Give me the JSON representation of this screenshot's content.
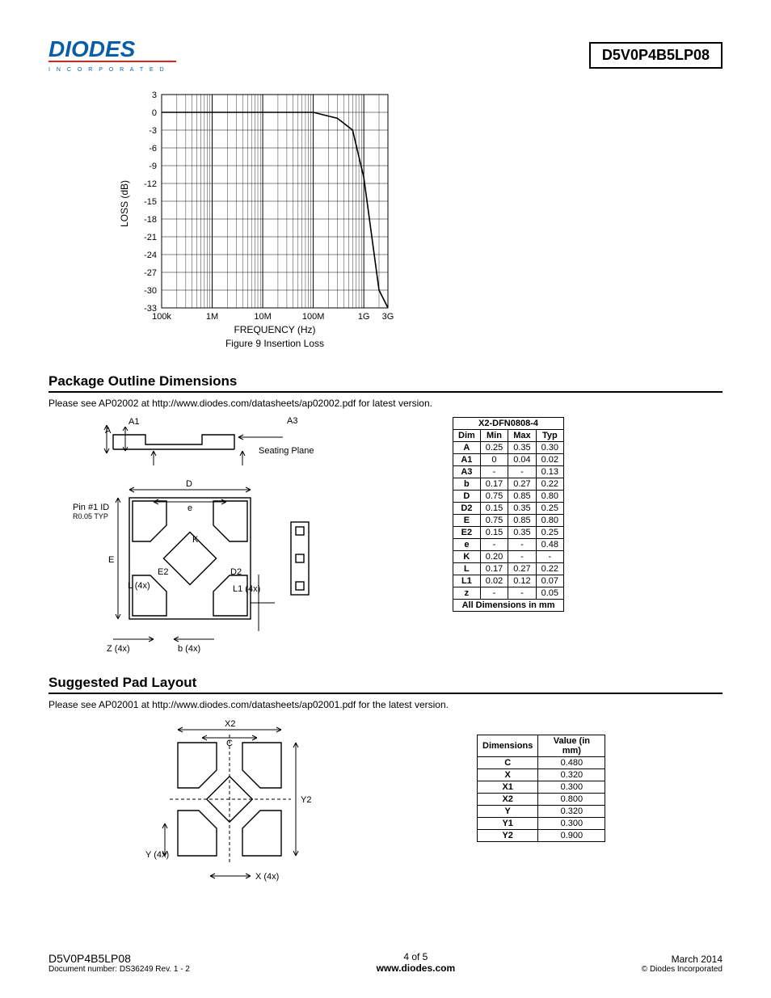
{
  "header": {
    "part_number": "D5V0P4B5LP08",
    "logo_tag": "I N C O R P O R A T E D"
  },
  "chart_data": {
    "type": "line",
    "title": "Figure 9 Insertion Loss",
    "xlabel": "FREQUENCY (Hz)",
    "ylabel": "LOSS (dB)",
    "y_ticks": [
      3,
      0,
      -3,
      -6,
      -9,
      -12,
      -15,
      -18,
      -21,
      -24,
      -27,
      -30,
      -33
    ],
    "x_ticks": [
      "100k",
      "1M",
      "10M",
      "100M",
      "1G",
      "3G"
    ],
    "ylim": [
      -33,
      3
    ],
    "series": [
      {
        "name": "Insertion Loss",
        "points": [
          {
            "f": "100k",
            "db": 0
          },
          {
            "f": "1M",
            "db": 0
          },
          {
            "f": "10M",
            "db": 0
          },
          {
            "f": "100M",
            "db": 0
          },
          {
            "f": "300M",
            "db": -1
          },
          {
            "f": "600M",
            "db": -3
          },
          {
            "f": "1G",
            "db": -11
          },
          {
            "f": "2G",
            "db": -30
          },
          {
            "f": "3G",
            "db": -33
          }
        ]
      }
    ]
  },
  "sections": {
    "pkg": {
      "title": "Package Outline Dimensions",
      "note": "Please see AP02002 at http://www.diodes.com/datasheets/ap02002.pdf for latest version."
    },
    "pad": {
      "title": "Suggested Pad Layout",
      "note": "Please see AP02001 at http://www.diodes.com/datasheets/ap02001.pdf for the latest version."
    }
  },
  "pkg_diagram": {
    "labels": [
      "A",
      "A1",
      "A3",
      "Seating Plane",
      "Pin #1 ID",
      "R0.05 TYP",
      "D",
      "e",
      "K",
      "E",
      "E2",
      "D2",
      "L (4x)",
      "L1 (4x)",
      "Z (4x)",
      "b (4x)"
    ]
  },
  "dim_table": {
    "title": "X2-DFN0808-4",
    "headers": [
      "Dim",
      "Min",
      "Max",
      "Typ"
    ],
    "rows": [
      [
        "A",
        "0.25",
        "0.35",
        "0.30"
      ],
      [
        "A1",
        "0",
        "0.04",
        "0.02"
      ],
      [
        "A3",
        "-",
        "-",
        "0.13"
      ],
      [
        "b",
        "0.17",
        "0.27",
        "0.22"
      ],
      [
        "D",
        "0.75",
        "0.85",
        "0.80"
      ],
      [
        "D2",
        "0.15",
        "0.35",
        "0.25"
      ],
      [
        "E",
        "0.75",
        "0.85",
        "0.80"
      ],
      [
        "E2",
        "0.15",
        "0.35",
        "0.25"
      ],
      [
        "e",
        "-",
        "-",
        "0.48"
      ],
      [
        "K",
        "0.20",
        "-",
        "-"
      ],
      [
        "L",
        "0.17",
        "0.27",
        "0.22"
      ],
      [
        "L1",
        "0.02",
        "0.12",
        "0.07"
      ],
      [
        "z",
        "-",
        "-",
        "0.05"
      ]
    ],
    "footer": "All Dimensions in mm"
  },
  "pad_diagram": {
    "labels": [
      "X2",
      "C",
      "Y2",
      "Y (4x)",
      "X (4x)"
    ]
  },
  "pad_table": {
    "headers": [
      "Dimensions",
      "Value (in mm)"
    ],
    "rows": [
      [
        "C",
        "0.480"
      ],
      [
        "X",
        "0.320"
      ],
      [
        "X1",
        "0.300"
      ],
      [
        "X2",
        "0.800"
      ],
      [
        "Y",
        "0.320"
      ],
      [
        "Y1",
        "0.300"
      ],
      [
        "Y2",
        "0.900"
      ]
    ]
  },
  "footer": {
    "part": "D5V0P4B5LP08",
    "doc": "Document number: DS36249  Rev. 1 - 2",
    "page": "4 of 5",
    "url": "www.diodes.com",
    "date": "March 2014",
    "copy": "© Diodes Incorporated"
  }
}
